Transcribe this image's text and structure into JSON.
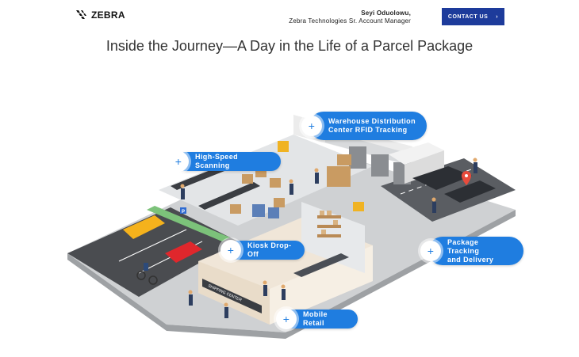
{
  "header": {
    "logo_text": "ZEBRA",
    "presenter_name": "Seyi Oduolowu,",
    "presenter_role": "Zebra Technologies Sr. Account Manager",
    "contact_label": "CONTACT US",
    "contact_arrow": "›"
  },
  "page": {
    "title": "Inside the Journey—A Day in the Life of a Parcel Package"
  },
  "hotspots": {
    "warehouse_line1": "Warehouse Distribution",
    "warehouse_line2": "Center RFID Tracking",
    "scanning": "High-Speed Scanning",
    "kiosk": "Kiosk Drop-Off",
    "tracking_line1": "Package Tracking",
    "tracking_line2": "and Delivery",
    "retail": "Mobile Retail",
    "plus": "+"
  },
  "scene": {
    "sign_text": "SHIPPING CENTER",
    "parking_sign": "P"
  },
  "colors": {
    "accent": "#1f7de0",
    "contact_bg": "#1d3b9b"
  }
}
